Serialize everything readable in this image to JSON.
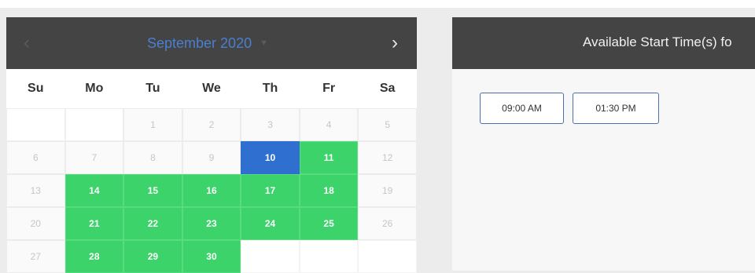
{
  "calendar": {
    "month_label": "September 2020",
    "prev_icon": "chevron-left-icon",
    "next_icon": "chevron-right-icon",
    "dropdown_icon": "caret-down-icon",
    "weekdays": [
      "Su",
      "Mo",
      "Tu",
      "We",
      "Th",
      "Fr",
      "Sa"
    ],
    "weeks": [
      [
        {
          "d": "",
          "s": "empty"
        },
        {
          "d": "",
          "s": "empty"
        },
        {
          "d": "1",
          "s": "disabled"
        },
        {
          "d": "2",
          "s": "disabled"
        },
        {
          "d": "3",
          "s": "disabled"
        },
        {
          "d": "4",
          "s": "disabled"
        },
        {
          "d": "5",
          "s": "disabled"
        }
      ],
      [
        {
          "d": "6",
          "s": "disabled"
        },
        {
          "d": "7",
          "s": "disabled"
        },
        {
          "d": "8",
          "s": "disabled"
        },
        {
          "d": "9",
          "s": "disabled"
        },
        {
          "d": "10",
          "s": "selected"
        },
        {
          "d": "11",
          "s": "available"
        },
        {
          "d": "12",
          "s": "disabled"
        }
      ],
      [
        {
          "d": "13",
          "s": "disabled"
        },
        {
          "d": "14",
          "s": "available"
        },
        {
          "d": "15",
          "s": "available"
        },
        {
          "d": "16",
          "s": "available"
        },
        {
          "d": "17",
          "s": "available"
        },
        {
          "d": "18",
          "s": "available"
        },
        {
          "d": "19",
          "s": "disabled"
        }
      ],
      [
        {
          "d": "20",
          "s": "disabled"
        },
        {
          "d": "21",
          "s": "available"
        },
        {
          "d": "22",
          "s": "available"
        },
        {
          "d": "23",
          "s": "available"
        },
        {
          "d": "24",
          "s": "available"
        },
        {
          "d": "25",
          "s": "available"
        },
        {
          "d": "26",
          "s": "disabled"
        }
      ],
      [
        {
          "d": "27",
          "s": "disabled"
        },
        {
          "d": "28",
          "s": "available"
        },
        {
          "d": "29",
          "s": "available"
        },
        {
          "d": "30",
          "s": "available"
        },
        {
          "d": "",
          "s": "blank"
        },
        {
          "d": "",
          "s": "blank"
        },
        {
          "d": "",
          "s": "blank"
        }
      ]
    ],
    "colors": {
      "header_bg": "#444444",
      "available": "#3cd36a",
      "selected": "#2f6fd0",
      "month_text": "#4a7fcf"
    }
  },
  "times": {
    "title": "Available Start Time(s) fo",
    "slots": [
      "09:00 AM",
      "01:30 PM"
    ]
  }
}
